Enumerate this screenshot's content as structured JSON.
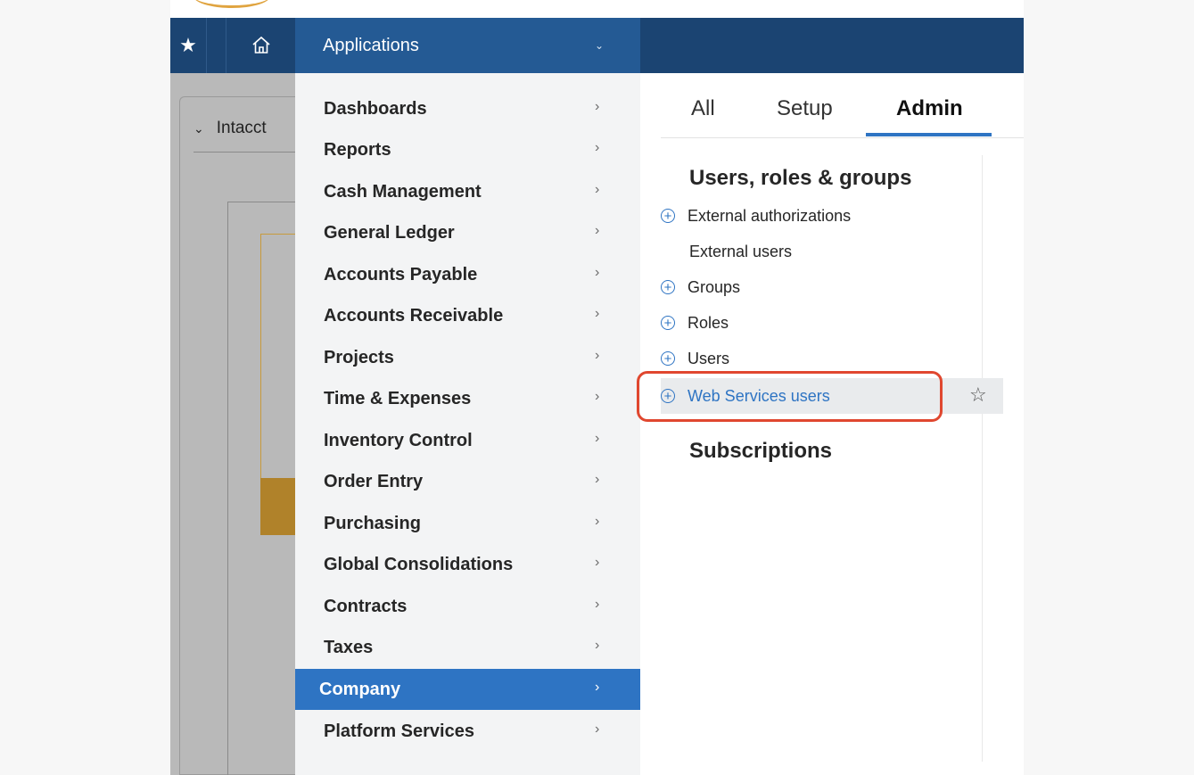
{
  "topbar": {
    "favorites_icon": "star-icon",
    "home_icon": "home-icon",
    "applications_label": "Applications",
    "applications_chevron": "chevron-down-icon"
  },
  "background": {
    "panel_title": "Intacct"
  },
  "menu": {
    "items": [
      {
        "label": "Dashboards"
      },
      {
        "label": "Reports"
      },
      {
        "label": "Cash Management"
      },
      {
        "label": "General Ledger"
      },
      {
        "label": "Accounts Payable"
      },
      {
        "label": "Accounts Receivable"
      },
      {
        "label": "Projects"
      },
      {
        "label": "Time & Expenses"
      },
      {
        "label": "Inventory Control"
      },
      {
        "label": "Order Entry"
      },
      {
        "label": "Purchasing"
      },
      {
        "label": "Global Consolidations"
      },
      {
        "label": "Contracts"
      },
      {
        "label": "Taxes"
      },
      {
        "label": "Company",
        "active": true
      },
      {
        "label": "Platform Services"
      }
    ]
  },
  "tabs": [
    {
      "label": "All"
    },
    {
      "label": "Setup"
    },
    {
      "label": "Admin",
      "active": true
    }
  ],
  "sections": {
    "users_title": "Users, roles & groups",
    "links": [
      {
        "label": "External authorizations",
        "add": true
      },
      {
        "label": "External users",
        "add": false
      },
      {
        "label": "Groups",
        "add": true
      },
      {
        "label": "Roles",
        "add": true
      },
      {
        "label": "Users",
        "add": true
      },
      {
        "label": "Web Services users",
        "add": true,
        "highlighted": true
      }
    ],
    "subscriptions_title": "Subscriptions"
  },
  "colors": {
    "topbar": "#1b4472",
    "accent": "#2e74c3",
    "callout": "#e0472f"
  }
}
